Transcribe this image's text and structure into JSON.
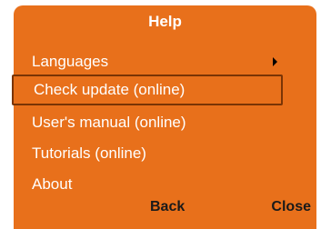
{
  "menu": {
    "title": "Help",
    "items": [
      {
        "label": "Languages",
        "has_submenu": true
      },
      {
        "label": "Check update (online)",
        "selected": true
      },
      {
        "label": "User's manual (online)"
      },
      {
        "label": "Tutorials (online)"
      },
      {
        "label": "About"
      }
    ],
    "back_label": "Back",
    "close_label": "Close"
  },
  "colors": {
    "panel": "#e8701b",
    "selection_border": "#7a3405",
    "text": "#ffffff",
    "footer_text": "#1a1a1a"
  },
  "icons": {
    "submenu": "chevron-right-icon"
  }
}
